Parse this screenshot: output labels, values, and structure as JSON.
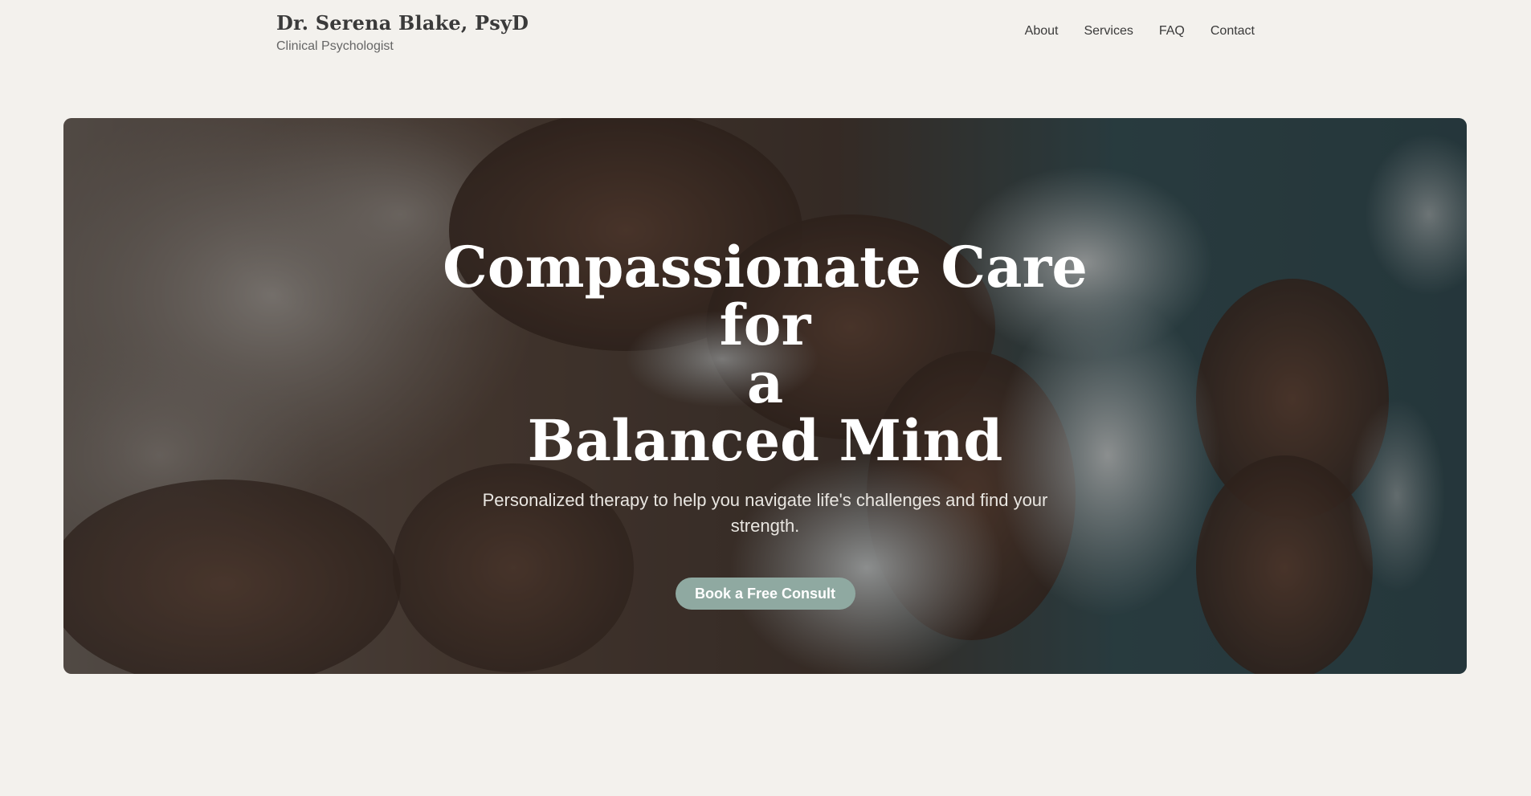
{
  "header": {
    "brand_name": "Dr. Serena Blake, PsyD",
    "brand_subtitle": "Clinical Psychologist",
    "nav": [
      {
        "label": "About"
      },
      {
        "label": "Services"
      },
      {
        "label": "FAQ"
      },
      {
        "label": "Contact"
      }
    ]
  },
  "hero": {
    "title_line1": "Compassionate Care for",
    "title_line2": "a",
    "title_line3": "Balanced Mind",
    "subtitle": "Personalized therapy to help you navigate life's challenges and find your strength.",
    "cta_label": "Book a Free Consult",
    "background_image": "aerial-rocky-coastline-photo"
  },
  "colors": {
    "page_bg": "#f3f1ed",
    "text_dark": "#3a3a3a",
    "cta_bg": "#8fa9a1",
    "hero_text": "#ffffff"
  }
}
